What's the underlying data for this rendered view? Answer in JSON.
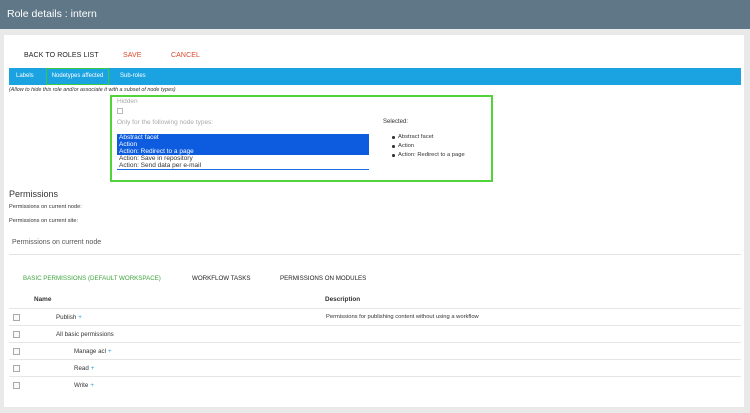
{
  "window": {
    "title": "Role details : intern"
  },
  "actions": {
    "back": "BACK TO ROLES LIST",
    "save": "SAVE",
    "cancel": "CANCEL"
  },
  "tabs": [
    {
      "label": "Labels"
    },
    {
      "label": "Nodetypes affected"
    },
    {
      "label": "Sub-roles"
    }
  ],
  "nodetypes": {
    "note": "(Allow to hide this role and/or associate it with a subset of node types)",
    "hidden_label": "Hidden",
    "only_label": "Only for the following node types:",
    "options": [
      {
        "label": "Abstract facet",
        "selected": true
      },
      {
        "label": "Action",
        "selected": true
      },
      {
        "label": "Action: Redirect to a page",
        "selected": true
      },
      {
        "label": "Action: Save in repository",
        "selected": false
      },
      {
        "label": "Action: Send data per e-mail",
        "selected": false
      }
    ],
    "selected_label": "Selected:",
    "selected_items": [
      "Abstract facet",
      "Action",
      "Action: Redirect to a page"
    ]
  },
  "permissions": {
    "title": "Permissions",
    "on_node_label": "Permissions on current node:",
    "on_site_label": "Permissions on current site:",
    "section_title": "Permissions on current node",
    "subtabs": [
      "BASIC PERMISSIONS (DEFAULT WORKSPACE)",
      "WORKFLOW TASKS",
      "PERMISSIONS ON MODULES"
    ],
    "columns": {
      "name": "Name",
      "description": "Description"
    },
    "rows": [
      {
        "name": "Publish",
        "plus": "+",
        "description": "Permissions for publishing content without using a workflow"
      },
      {
        "name": "All basic permissions",
        "plus": "",
        "description": ""
      },
      {
        "name": "Manage acl",
        "plus": "+",
        "description": ""
      },
      {
        "name": "Read",
        "plus": "+",
        "description": ""
      },
      {
        "name": "Write",
        "plus": "+",
        "description": ""
      }
    ]
  },
  "colors": {
    "titlebar": "#5f7787",
    "tabbar": "#1aa3e0",
    "accent_red": "#d9472b",
    "accent_green": "#3fa33f",
    "highlight_box": "#52d33b",
    "list_selection": "#0d5ce0"
  }
}
